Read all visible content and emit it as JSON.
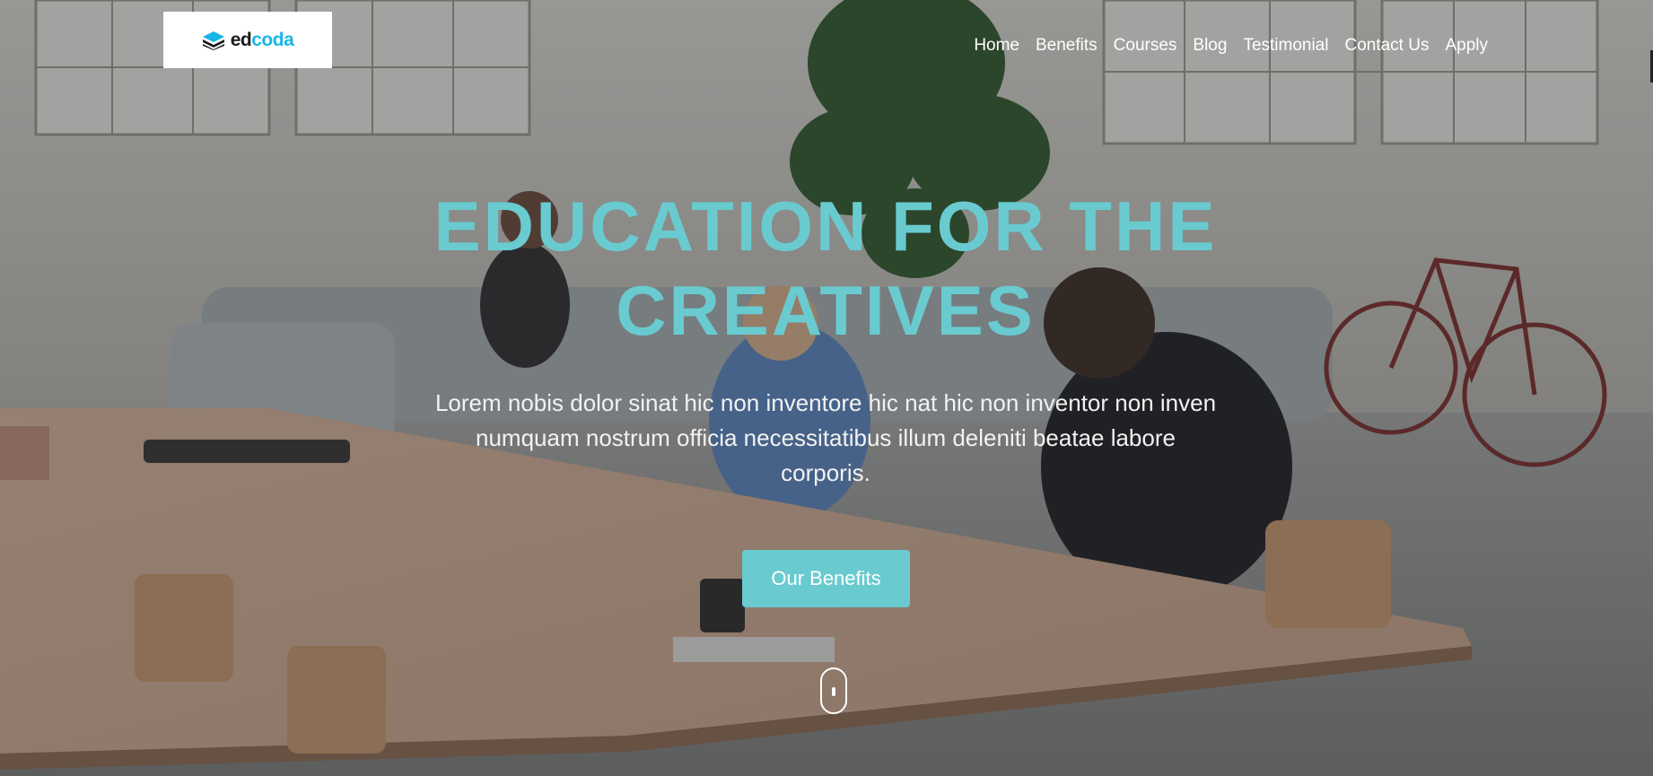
{
  "header": {
    "logo": {
      "part_dark": "ed",
      "part_accent": "coda",
      "icon": "stacked-layers-icon"
    },
    "nav": [
      {
        "label": "Home"
      },
      {
        "label": "Benefits"
      },
      {
        "label": "Courses"
      },
      {
        "label": "Blog"
      },
      {
        "label": "Testimonial"
      },
      {
        "label": "Contact Us"
      },
      {
        "label": "Apply"
      }
    ]
  },
  "hero": {
    "title": "EDUCATION FOR THE CREATIVES",
    "description": "Lorem nobis dolor sinat hic non inventore hic nat hic non inventor non inven numquam nostrum officia necessitatibus illum deleniti beatae labore corporis.",
    "cta_label": "Our Benefits",
    "scroll_icon": "mouse-scroll-icon"
  },
  "colors": {
    "accent": "#69cbcf",
    "logo_accent": "#19b5e6",
    "nav_text": "#ffffff"
  }
}
